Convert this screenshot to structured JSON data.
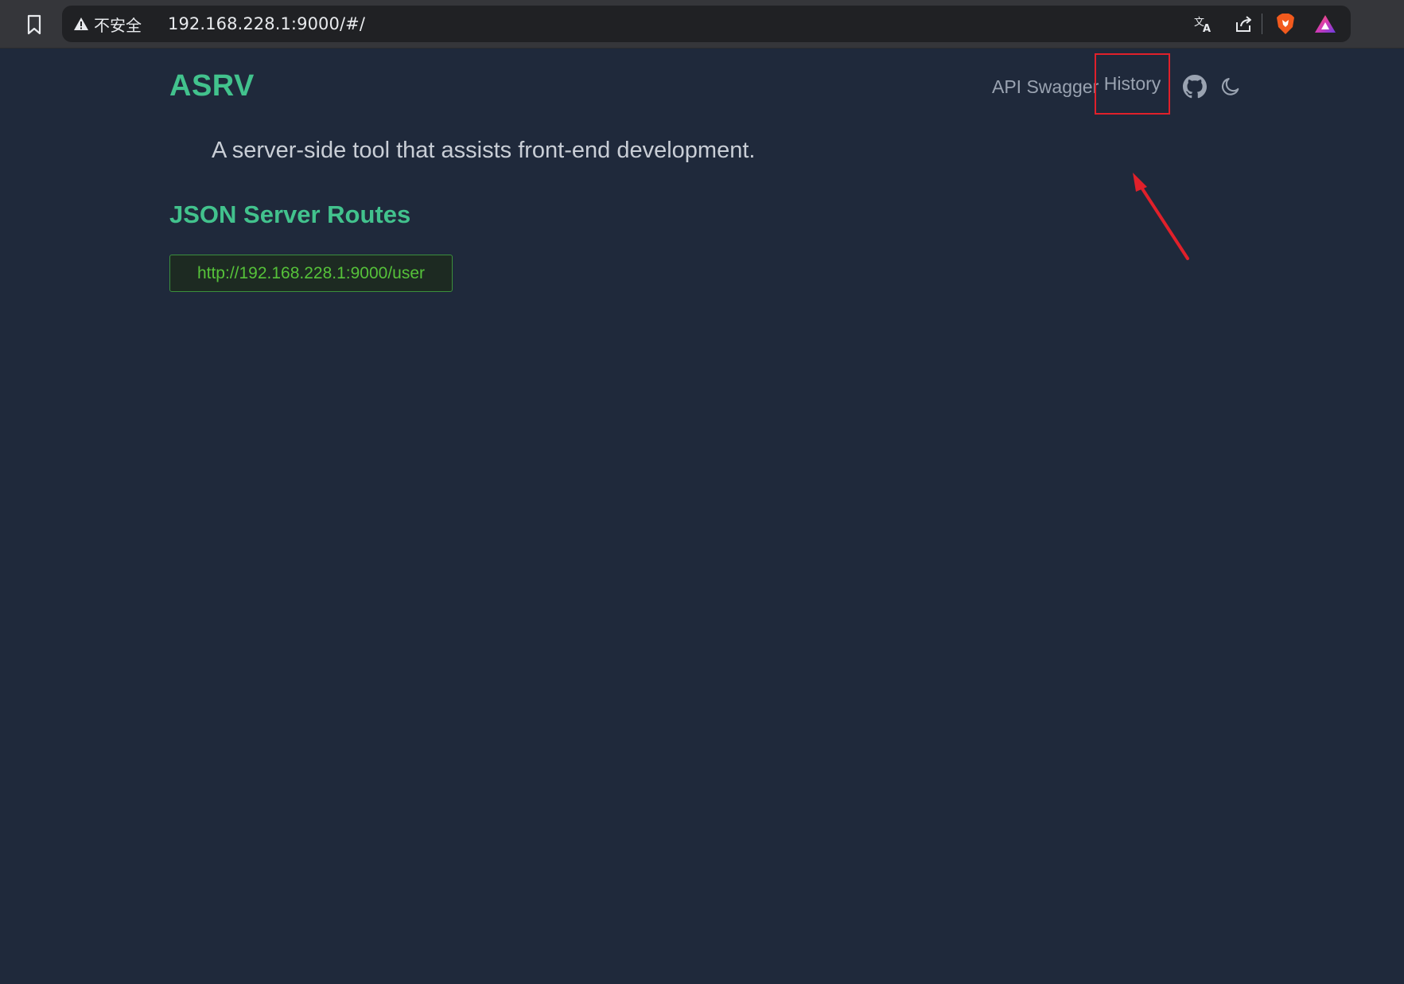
{
  "browser": {
    "security_label": "不安全",
    "url": "192.168.228.1:9000/#/",
    "icons": [
      "bookmark-icon",
      "warning-icon",
      "translate-icon",
      "share-icon",
      "brave-shield-icon",
      "brave-rewards-icon"
    ]
  },
  "header": {
    "brand": "ASRV",
    "nav": {
      "api_swagger": "API Swagger",
      "history": "History"
    },
    "icons": [
      "github-icon",
      "moon-icon"
    ]
  },
  "main": {
    "tagline": "A server-side tool that assists front-end development.",
    "routes_title": "JSON Server Routes",
    "routes": [
      "http://192.168.228.1:9000/user"
    ]
  },
  "colors": {
    "page_bg": "#1f293b",
    "accent_green": "#42c28d",
    "link_green": "#56c23a",
    "nav_text": "#9aa3b1",
    "highlight_red": "#e0202a"
  }
}
